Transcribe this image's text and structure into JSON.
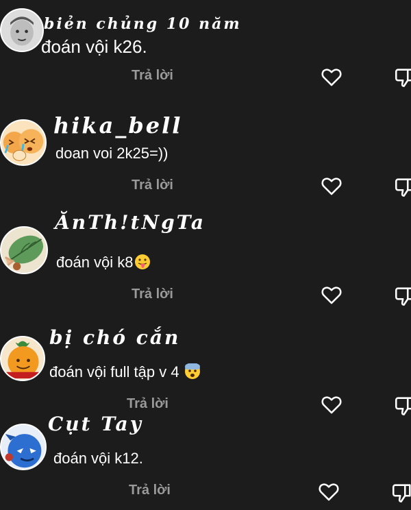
{
  "comments": [
    {
      "username": "biẻn chủng 10 năm",
      "text": "đoán vội k26.",
      "reply_label": "Trả lời",
      "avatar_icon": "gray-face-avatar",
      "like_icon": "heart-icon",
      "dislike_icon": "thumbs-down-icon"
    },
    {
      "username": "hika_bell",
      "text": "doan voi 2k25=))",
      "reply_label": "Trả lời",
      "avatar_icon": "crying-bun-avatar"
    },
    {
      "username": "ĂnTh!tNgTa",
      "text": "đoán vội k8",
      "text_emoji": "tongue-out-emoji",
      "reply_label": "Trả lời",
      "avatar_icon": "green-leaf-avatar"
    },
    {
      "username": "bị chó cắn",
      "text": "đoán vội full tập v 4",
      "text_emoji": "fearful-face-emoji",
      "reply_label": "Trả lời",
      "avatar_icon": "orange-fruit-avatar"
    },
    {
      "username": "Cụt Tay",
      "text": "đoán vội k12.",
      "reply_label": "Trả lời",
      "avatar_icon": "blue-character-avatar"
    }
  ],
  "colors": {
    "background": "#1c1c1c",
    "text": "#ffffff",
    "reply": "#9a9a9a"
  }
}
